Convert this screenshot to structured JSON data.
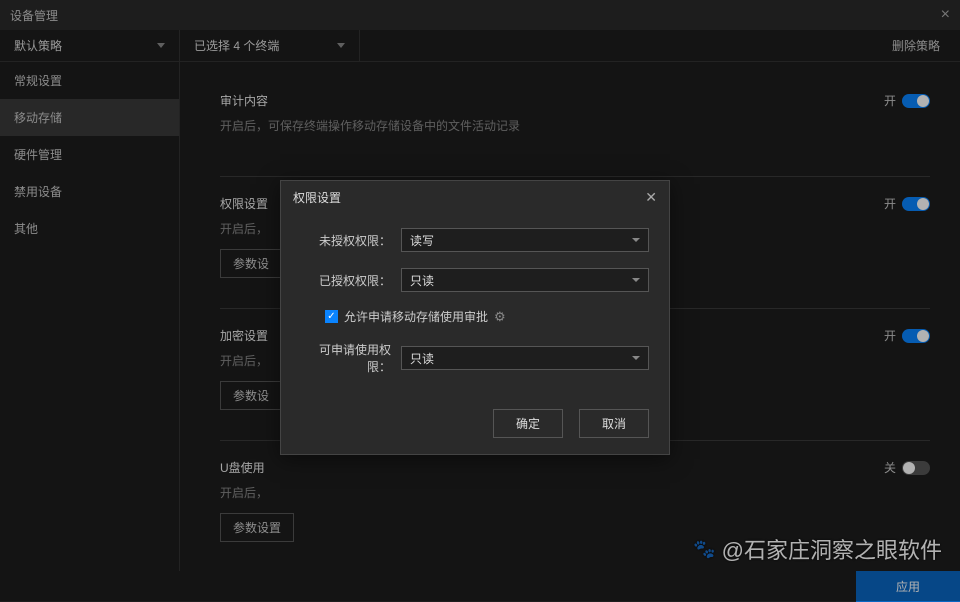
{
  "window": {
    "title": "设备管理",
    "close_icon": "×"
  },
  "topbar": {
    "policy": "默认策略",
    "terminals": "已选择 4 个终端",
    "delete": "删除策略"
  },
  "sidebar": {
    "items": [
      {
        "label": "常规设置"
      },
      {
        "label": "移动存储"
      },
      {
        "label": "硬件管理"
      },
      {
        "label": "禁用设备"
      },
      {
        "label": "其他"
      }
    ],
    "active_index": 1
  },
  "sections": [
    {
      "title": "审计内容",
      "desc": "开启后，可保存终端操作移动存储设备中的文件活动记录",
      "toggle_label": "开",
      "toggle_on": true,
      "has_param_btn": false
    },
    {
      "title": "权限设置",
      "desc": "开启后，",
      "toggle_label": "开",
      "toggle_on": true,
      "has_param_btn": true,
      "param_btn_label": "参数设"
    },
    {
      "title": "加密设置",
      "desc": "开启后，",
      "toggle_label": "开",
      "toggle_on": true,
      "has_param_btn": true,
      "param_btn_label": "参数设"
    },
    {
      "title": "U盘使用",
      "desc": "开启后，",
      "toggle_label": "关",
      "toggle_on": false,
      "has_param_btn": true,
      "param_btn_label": "参数设置"
    }
  ],
  "modal": {
    "title": "权限设置",
    "fields": {
      "unauthorized_label": "未授权权限：",
      "unauthorized_value": "读写",
      "authorized_label": "已授权权限：",
      "authorized_value": "只读",
      "checkbox_label": "允许申请移动存储使用审批",
      "applicable_label": "可申请使用权限：",
      "applicable_value": "只读"
    },
    "buttons": {
      "ok": "确定",
      "cancel": "取消"
    }
  },
  "footer": {
    "apply": "应用"
  },
  "watermark": "@石家庄洞察之眼软件"
}
